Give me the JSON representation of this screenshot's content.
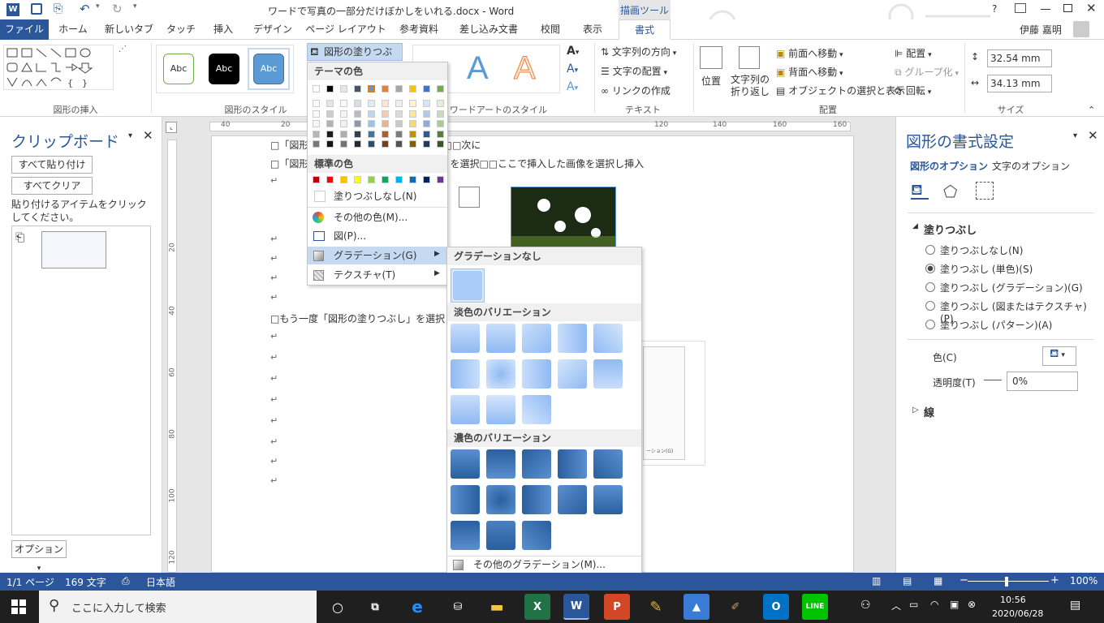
{
  "window": {
    "title": "ワードで写真の一部分だけぼかしをいれる.docx - Word",
    "context_tab": "描画ツール",
    "help": "?",
    "user": "伊藤 嘉明"
  },
  "tabs": [
    {
      "label": "ファイル"
    },
    {
      "label": "ホーム"
    },
    {
      "label": "新しいタブ"
    },
    {
      "label": "タッチ"
    },
    {
      "label": "挿入"
    },
    {
      "label": "デザイン"
    },
    {
      "label": "ページ レイアウト"
    },
    {
      "label": "参考資料"
    },
    {
      "label": "差し込み文書"
    },
    {
      "label": "校閲"
    },
    {
      "label": "表示"
    },
    {
      "label": "書式"
    }
  ],
  "ribbon": {
    "groups": {
      "insert_shapes": "図形の挿入",
      "shape_styles": "図形のスタイル",
      "wordart": "ワードアートのスタイル",
      "text": "テキスト",
      "arrange": "配置",
      "size": "サイズ"
    },
    "shape_style_abc": "Abc",
    "wordart_letter": "A",
    "fill_button": "図形の塗りつぶし",
    "text_direction": "文字列の方向",
    "text_align": "文字の配置",
    "create_link": "リンクの作成",
    "position": "位置",
    "wrap_text": "文字列の折り返し",
    "bring_forward": "前面へ移動",
    "send_backward": "背面へ移動",
    "selection_pane": "オブジェクトの選択と表示",
    "align": "配置",
    "group": "グループ化",
    "rotate": "回転",
    "height": "32.54 mm",
    "width": "34.13 mm"
  },
  "clipboard": {
    "title": "クリップボード",
    "paste_all": "すべて貼り付け",
    "clear_all": "すべてクリア",
    "hint": "貼り付けるアイテムをクリックしてください。",
    "options": "オプション"
  },
  "document": {
    "ruler_marks": [
      "40",
      "20",
      "20",
      "40",
      "60",
      "80",
      "100",
      "120",
      "140",
      "160"
    ],
    "vruler_marks": [
      "20",
      "40",
      "60",
      "80",
      "100",
      "120"
    ],
    "line1": "□「図形の枠線」→「線なし」を選択□□□次に",
    "line2": "□「図形の塗りつぶし」を選択し、「図」を選択□□ここで挿入した画像を選択し挿入",
    "line3": "□もう一度「図形の塗りつぶし」を選択し",
    "para_mark": "↵",
    "thumb_text": "ーション(G)"
  },
  "fill_menu": {
    "theme_colors": "テーマの色",
    "standard_colors": "標準の色",
    "no_fill": "塗りつぶしなし(N)",
    "more_colors": "その他の色(M)...",
    "picture": "図(P)...",
    "gradient": "グラデーション(G)",
    "texture": "テクスチャ(T)",
    "theme_row": [
      "#ffffff",
      "#000000",
      "#e7e6e6",
      "#44546a",
      "#5b9bd5",
      "#ed7d31",
      "#a5a5a5",
      "#ffc000",
      "#4472c4",
      "#70ad47"
    ],
    "standard_row": [
      "#c00000",
      "#ff0000",
      "#ffc000",
      "#ffff00",
      "#92d050",
      "#00b050",
      "#00b0f0",
      "#0070c0",
      "#002060",
      "#7030a0"
    ]
  },
  "gradient_menu": {
    "no_gradient": "グラデーションなし",
    "light": "淡色のバリエーション",
    "dark": "濃色のバリエーション",
    "more": "その他のグラデーション(M)...",
    "dots": "....."
  },
  "format_pane": {
    "title": "図形の書式設定",
    "tab_shape": "図形のオプション",
    "tab_text": "文字のオプション",
    "fill_section": "塗りつぶし",
    "options": [
      "塗りつぶしなし(N)",
      "塗りつぶし (単色)(S)",
      "塗りつぶし (グラデーション)(G)",
      "塗りつぶし (図またはテクスチャ)(P)",
      "塗りつぶし (パターン)(A)"
    ],
    "selected": 1,
    "color_label": "色(C)",
    "transparency_label": "透明度(T)",
    "transparency_value": "0%",
    "line_section": "線"
  },
  "status": {
    "page": "1/1 ページ",
    "words": "169 文字",
    "lang": "日本語",
    "zoom": "100%"
  },
  "taskbar": {
    "search": "ここに入力して検索",
    "time": "10:56",
    "date": "2020/06/28"
  }
}
